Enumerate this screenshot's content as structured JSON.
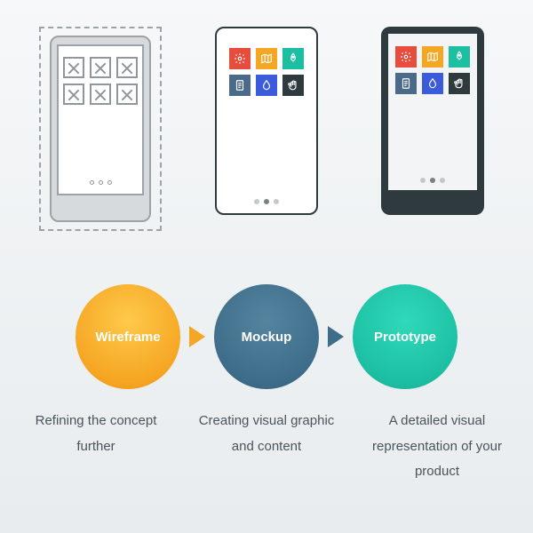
{
  "stages": [
    {
      "name": "Wireframe",
      "desc": "Refining the concept further",
      "color": "#f5a623"
    },
    {
      "name": "Mockup",
      "desc": "Creating visual graphic and content",
      "color": "#3d6d8a"
    },
    {
      "name": "Prototype",
      "desc": "A detailed visual representation of your product",
      "color": "#1dbfa2"
    }
  ],
  "app_icons": [
    {
      "name": "gear",
      "color": "#e74c3c"
    },
    {
      "name": "map",
      "color": "#f5a623"
    },
    {
      "name": "rocket",
      "color": "#1dbfa2"
    },
    {
      "name": "doc",
      "color": "#4a6a8a"
    },
    {
      "name": "drop",
      "color": "#3b5bdb"
    },
    {
      "name": "hand",
      "color": "#2f3a3e"
    }
  ]
}
